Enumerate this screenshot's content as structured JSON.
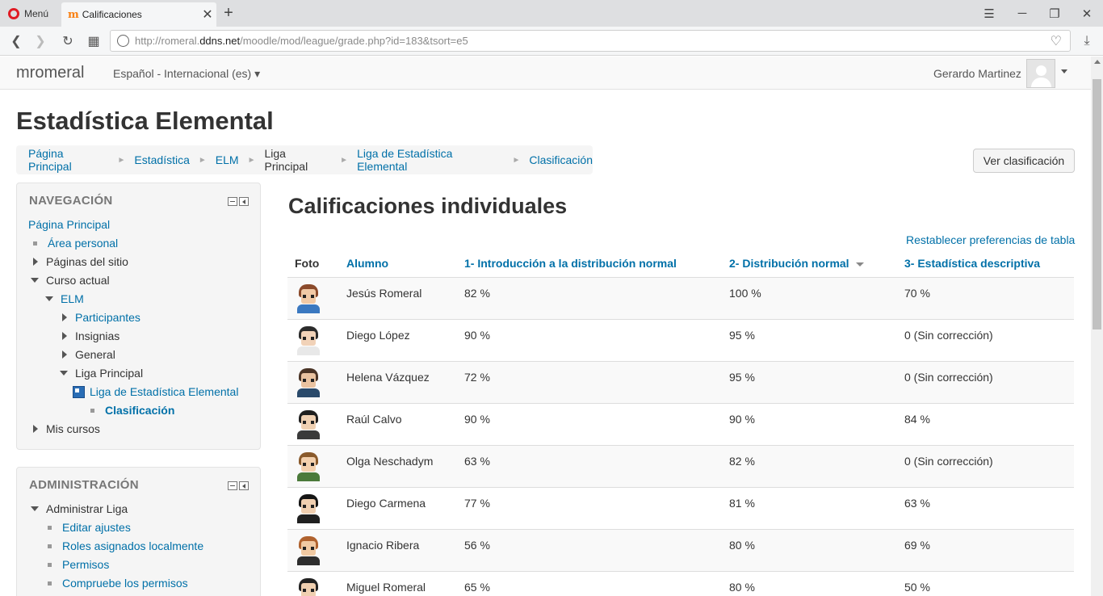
{
  "browser": {
    "menu_label": "Menú",
    "tab_title": "Calificaciones",
    "url_prefix": "http://romeral.",
    "url_host": "ddns.net",
    "url_path": "/moodle/mod/league/grade.php?id=183&tsort=e5"
  },
  "navbar": {
    "brand": "mromeral",
    "language": "Español - Internacional (es) ▾",
    "user_name": "Gerardo Martinez"
  },
  "page": {
    "course_title": "Estadística Elemental",
    "view_button": "Ver clasificación",
    "main_title": "Calificaciones individuales",
    "reset_link": "Restablecer preferencias de tabla"
  },
  "breadcrumb": [
    {
      "label": "Página Principal",
      "link": true
    },
    {
      "label": "Estadística",
      "link": true
    },
    {
      "label": "ELM",
      "link": true
    },
    {
      "label": "Liga Principal",
      "link": false
    },
    {
      "label": "Liga de Estadística Elemental",
      "link": true
    },
    {
      "label": "Clasificación",
      "link": true
    }
  ],
  "nav_block": {
    "title": "NAVEGACIÓN",
    "items": [
      "Página Principal",
      "Área personal",
      "Páginas del sitio",
      "Curso actual",
      "ELM",
      "Participantes",
      "Insignias",
      "General",
      "Liga Principal",
      "Liga de Estadística Elemental",
      "Clasificación",
      "Mis cursos"
    ]
  },
  "admin_block": {
    "title": "ADMINISTRACIÓN",
    "items": [
      "Administrar Liga",
      "Editar ajustes",
      "Roles asignados localmente",
      "Permisos",
      "Compruebe los permisos"
    ]
  },
  "table": {
    "headers": {
      "photo": "Foto",
      "student": "Alumno",
      "ex1": "1- Introducción a la distribución normal",
      "ex2": "2- Distribución normal",
      "ex3": "3- Estadística descriptiva"
    },
    "rows": [
      {
        "name": "Jesús Romeral",
        "g1": "82 %",
        "g2": "100 %",
        "g3": "70 %",
        "hair": "#8b4a2b",
        "face": "#f1c9a5",
        "shirt": "#3a78c0"
      },
      {
        "name": "Diego López",
        "g1": "90 %",
        "g2": "95 %",
        "g3": "0 (Sin corrección)",
        "hair": "#2b2b2b",
        "face": "#f1d2b8",
        "shirt": "#e8e8e8"
      },
      {
        "name": "Helena Vázquez",
        "g1": "72 %",
        "g2": "95 %",
        "g3": "0 (Sin corrección)",
        "hair": "#4a3426",
        "face": "#e9c2a0",
        "shirt": "#2a4a6b"
      },
      {
        "name": "Raúl Calvo",
        "g1": "90 %",
        "g2": "90 %",
        "g3": "84 %",
        "hair": "#1f1f1f",
        "face": "#efd0b2",
        "shirt": "#3a3a3a"
      },
      {
        "name": "Olga Neschadym",
        "g1": "63 %",
        "g2": "82 %",
        "g3": "0 (Sin corrección)",
        "hair": "#8a5a2c",
        "face": "#f3d0ad",
        "shirt": "#4b7a3a"
      },
      {
        "name": "Diego Carmena",
        "g1": "77 %",
        "g2": "81 %",
        "g3": "63 %",
        "hair": "#151515",
        "face": "#f0cfb0",
        "shirt": "#202020"
      },
      {
        "name": "Ignacio Ribera",
        "g1": "56 %",
        "g2": "80 %",
        "g3": "69 %",
        "hair": "#b0622e",
        "face": "#f0c9a2",
        "shirt": "#2d2d2d"
      },
      {
        "name": "Miguel Romeral",
        "g1": "65 %",
        "g2": "80 %",
        "g3": "50 %",
        "hair": "#222222",
        "face": "#efcfb0",
        "shirt": "#333333"
      }
    ]
  }
}
